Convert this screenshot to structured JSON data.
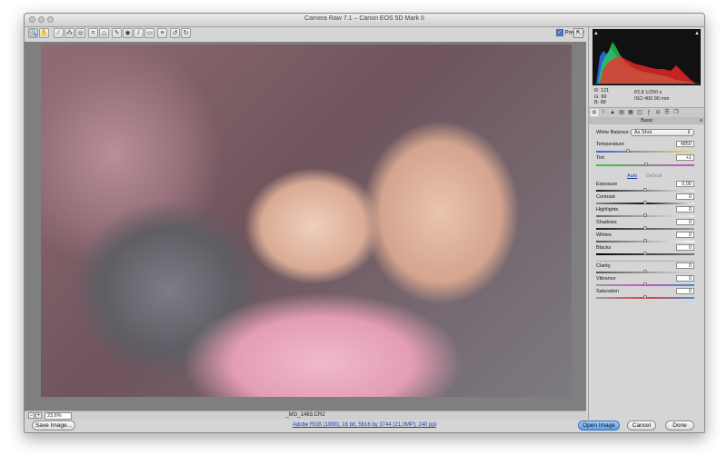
{
  "window": {
    "title": "Camera Raw 7.1  –  Canon EOS 5D Mark II"
  },
  "toolbar": {
    "tools": [
      {
        "icon": "zoom-icon",
        "glyph": "🔍"
      },
      {
        "icon": "hand-icon",
        "glyph": "✋"
      },
      {
        "icon": "white-balance-icon",
        "glyph": "⁄"
      },
      {
        "icon": "color-sampler-icon",
        "glyph": "⁂"
      },
      {
        "icon": "targeted-adjustment-icon",
        "glyph": "◎"
      },
      {
        "icon": "crop-icon",
        "glyph": "⌗"
      },
      {
        "icon": "straighten-icon",
        "glyph": "△"
      },
      {
        "icon": "spot-removal-icon",
        "glyph": "✎"
      },
      {
        "icon": "red-eye-icon",
        "glyph": "◉"
      },
      {
        "icon": "adjustment-brush-icon",
        "glyph": "/"
      },
      {
        "icon": "graduated-filter-icon",
        "glyph": "▭"
      },
      {
        "icon": "preferences-icon",
        "glyph": "≡"
      },
      {
        "icon": "rotate-ccw-icon",
        "glyph": "↺"
      },
      {
        "icon": "rotate-cw-icon",
        "glyph": "↻"
      }
    ],
    "preview_label": "Preview",
    "preview_checked": true
  },
  "status": {
    "zoom_value": "23,6%",
    "filename": "_MG_1463.CR2"
  },
  "bottom": {
    "save_label": "Save Image...",
    "workflow_link": "Adobe RGB (1998); 16 bit; 5616 by 3744 (21,0MP); 240 ppi",
    "open_label": "Open Image",
    "cancel_label": "Cancel",
    "done_label": "Done"
  },
  "readout": {
    "r": "R:  121",
    "g": "G:   99",
    "b": "B:   88",
    "aperture_shutter": "f/2,8    1/250 s",
    "iso_focal": "ISO 400   90 mm"
  },
  "panel": {
    "title": "Basic",
    "white_balance_label": "White Balance:",
    "white_balance_value": "As Shot",
    "temperature_label": "Temperature",
    "temperature_value": "4850",
    "tint_label": "Tint",
    "tint_value": "+1",
    "auto_label": "Auto",
    "default_label": "Default",
    "exposure_label": "Exposure",
    "exposure_value": "0,00",
    "contrast_label": "Contrast",
    "contrast_value": "0",
    "highlights_label": "Highlights",
    "highlights_value": "0",
    "shadows_label": "Shadows",
    "shadows_value": "0",
    "whites_label": "Whites",
    "whites_value": "0",
    "blacks_label": "Blacks",
    "blacks_value": "0",
    "clarity_label": "Clarity",
    "clarity_value": "0",
    "vibrance_label": "Vibrance",
    "vibrance_value": "0",
    "saturation_label": "Saturation",
    "saturation_value": "0"
  },
  "colors": {
    "accent": "#3b7be0",
    "link": "#1a3fb3",
    "panel_bg": "#d5d5d5",
    "canvas_bg": "#7f7f7f"
  }
}
